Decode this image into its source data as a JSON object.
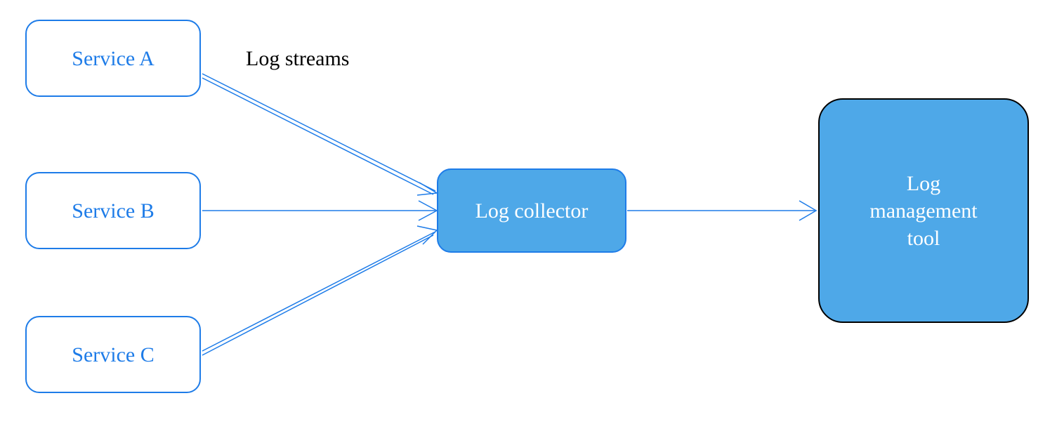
{
  "nodes": {
    "service_a": "Service A",
    "service_b": "Service B",
    "service_c": "Service C",
    "collector": "Log collector",
    "tool": "Log\nmanagement\ntool"
  },
  "labels": {
    "streams": "Log streams"
  },
  "colors": {
    "primary": "#1e7ce8",
    "fill": "#4ea8e8",
    "white": "#ffffff",
    "black": "#000000"
  },
  "arrows": [
    {
      "from": "service_a",
      "to": "collector",
      "double": true
    },
    {
      "from": "service_b",
      "to": "collector",
      "double": false
    },
    {
      "from": "service_c",
      "to": "collector",
      "double": true
    },
    {
      "from": "collector",
      "to": "tool",
      "double": false
    }
  ]
}
